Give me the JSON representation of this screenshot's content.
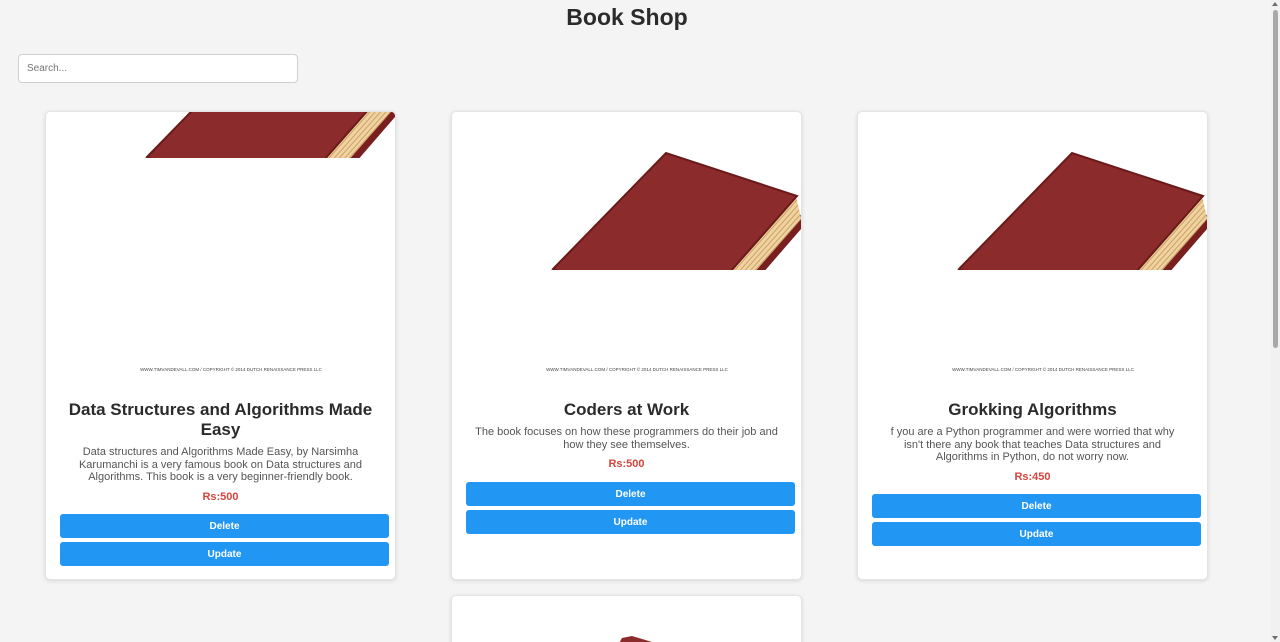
{
  "app": {
    "title": "Book Shop"
  },
  "search": {
    "placeholder": "Search...",
    "value": ""
  },
  "book_image": {
    "icon": "red-hardcover-book-image",
    "caption": "WWW.TIMVANDEVALL.COM / COPYRIGHT © 2014 DUTCH RENAISSANCE PRESS LLC",
    "cover_color": "#8b2b2b",
    "page_color": "#f1d4a3"
  },
  "books": [
    {
      "title": "Data Structures and Algorithms Made Easy",
      "description": "Data structures and Algorithms Made Easy, by Narsimha Karumanchi is a very famous book on Data structures and Algorithms. This book is a very beginner-friendly book.",
      "price": "Rs:500",
      "delete_label": "Delete",
      "update_label": "Update"
    },
    {
      "title": "Coders at Work",
      "description": "The book focuses on how these programmers do their job and how they see themselves.",
      "price": "Rs:500",
      "delete_label": "Delete",
      "update_label": "Update"
    },
    {
      "title": "Grokking Algorithms",
      "description": "f you are a Python programmer and were worried that why isn't there any book that teaches Data structures and Algorithms in Python, do not worry now.",
      "price": "Rs:450",
      "delete_label": "Delete",
      "update_label": "Update"
    }
  ],
  "colors": {
    "button": "#2196f3",
    "price": "#d6453d",
    "background": "#f4f4f4"
  }
}
